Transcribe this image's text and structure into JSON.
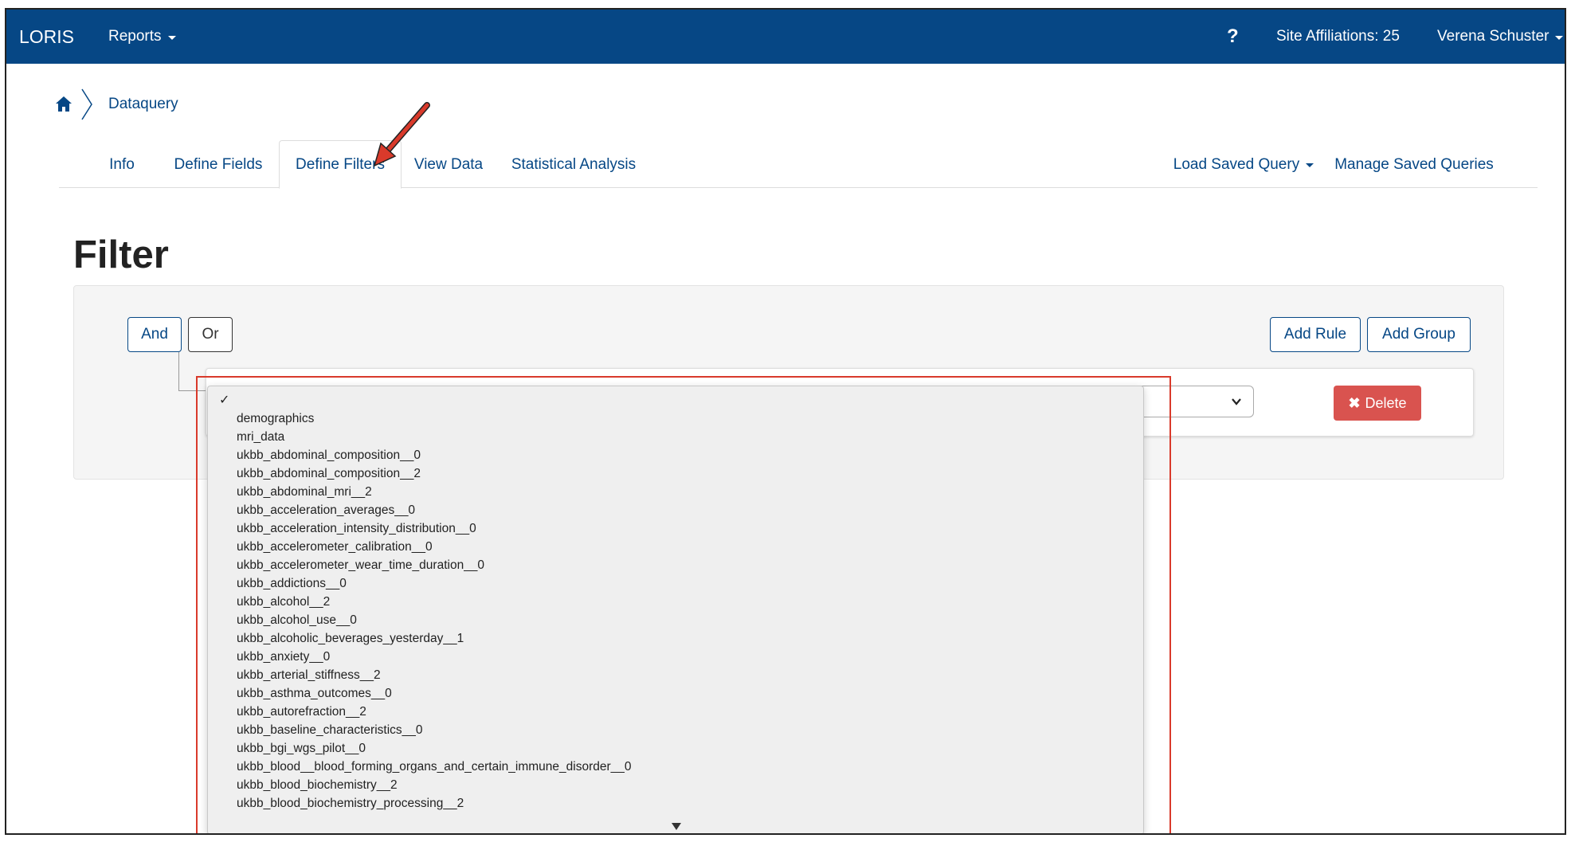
{
  "navbar": {
    "brand": "LORIS",
    "reports": "Reports",
    "help": "?",
    "site_affiliations": "Site Affiliations: 25",
    "user": "Verena Schuster"
  },
  "breadcrumb": {
    "current": "Dataquery"
  },
  "tabs": {
    "info": "Info",
    "define_fields": "Define Fields",
    "define_filters": "Define Filters",
    "view_data": "View Data",
    "statistical_analysis": "Statistical Analysis",
    "load_saved_query": "Load Saved Query",
    "manage_saved_queries": "Manage Saved Queries",
    "active": "Define Filters"
  },
  "page": {
    "title": "Filter"
  },
  "filter": {
    "and_label": "And",
    "or_label": "Or",
    "add_rule_label": "Add Rule",
    "add_group_label": "Add Group",
    "delete_label": "Delete",
    "delete_icon": "✖"
  },
  "dropdown": {
    "checkmark": "✓",
    "options": [
      "demographics",
      "mri_data",
      "ukbb_abdominal_composition__0",
      "ukbb_abdominal_composition__2",
      "ukbb_abdominal_mri__2",
      "ukbb_acceleration_averages__0",
      "ukbb_acceleration_intensity_distribution__0",
      "ukbb_accelerometer_calibration__0",
      "ukbb_accelerometer_wear_time_duration__0",
      "ukbb_addictions__0",
      "ukbb_alcohol__2",
      "ukbb_alcohol_use__0",
      "ukbb_alcoholic_beverages_yesterday__1",
      "ukbb_anxiety__0",
      "ukbb_arterial_stiffness__2",
      "ukbb_asthma_outcomes__0",
      "ukbb_autorefraction__2",
      "ukbb_baseline_characteristics__0",
      "ukbb_bgi_wgs_pilot__0",
      "ukbb_blood__blood_forming_organs_and_certain_immune_disorder__0",
      "ukbb_blood_biochemistry__2",
      "ukbb_blood_biochemistry_processing__2"
    ]
  },
  "colors": {
    "navbar": "#064785",
    "link": "#064785",
    "delete": "#d9534f",
    "highlight": "#d93a2b"
  }
}
